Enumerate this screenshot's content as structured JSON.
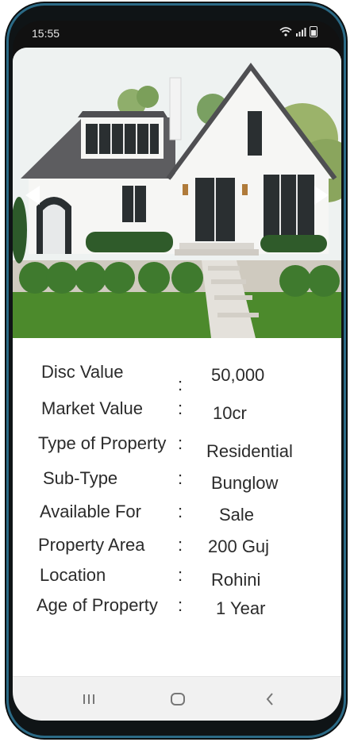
{
  "status_bar": {
    "time": "15:55",
    "icons": [
      "wifi-icon",
      "signal-icon",
      "battery-icon"
    ]
  },
  "hero": {
    "image_desc": "white cottage-style house with gabled roof, windows, lawn and shrubs",
    "left_arrow_icon": "chevron-left-icon",
    "right_arrow_icon": "chevron-right-icon"
  },
  "property": {
    "rows": [
      {
        "label": "Disc Value",
        "colon": ":",
        "value": "50,000"
      },
      {
        "label": "Market Value",
        "colon": ":",
        "value": "10cr"
      },
      {
        "label": "Type of Property",
        "colon": ":",
        "value": "Residential"
      },
      {
        "label": "Sub-Type",
        "colon": ":",
        "value": "Bunglow"
      },
      {
        "label": "Available For",
        "colon": ":",
        "value": "Sale"
      },
      {
        "label": "Property Area",
        "colon": ":",
        "value": "200 Guj"
      },
      {
        "label": "Location",
        "colon": ":",
        "value": "Rohini"
      },
      {
        "label": "Age of Property",
        "colon": ":",
        "value": "1 Year"
      }
    ]
  },
  "nav_bar": {
    "recents_icon": "recents-icon",
    "home_icon": "home-icon",
    "back_icon": "back-icon"
  },
  "colors": {
    "phone_body": "#0f1416",
    "phone_accent": "#2b6a86",
    "text": "#2b2b2b",
    "nav_bg": "#f1f1f1"
  }
}
